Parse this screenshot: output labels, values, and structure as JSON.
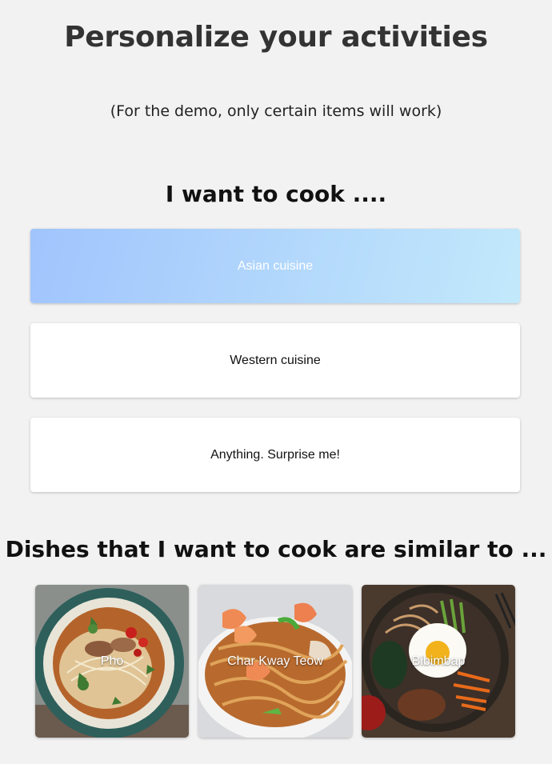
{
  "header": {
    "title": "Personalize your activities",
    "subtitle": "(For the demo, only certain items will work)"
  },
  "cook": {
    "heading": "I want to cook ....",
    "options": [
      {
        "label": "Asian cuisine",
        "selected": true
      },
      {
        "label": "Western cuisine",
        "selected": false
      },
      {
        "label": "Anything. Surprise me!",
        "selected": false
      }
    ]
  },
  "dishes": {
    "heading": "Dishes that I want to cook are similar to ...",
    "items": [
      {
        "label": "Pho",
        "image": "pho-bowl-photo"
      },
      {
        "label": "Char Kway Teow",
        "image": "stir-fried-noodles-shrimp-photo"
      },
      {
        "label": "Bibimbap",
        "image": "bibimbap-egg-bowl-photo"
      }
    ]
  },
  "colors": {
    "background": "#f2f2f2",
    "selected_gradient_start": "#a1c4fd",
    "selected_gradient_end": "#c2e9fb",
    "card": "#ffffff"
  }
}
